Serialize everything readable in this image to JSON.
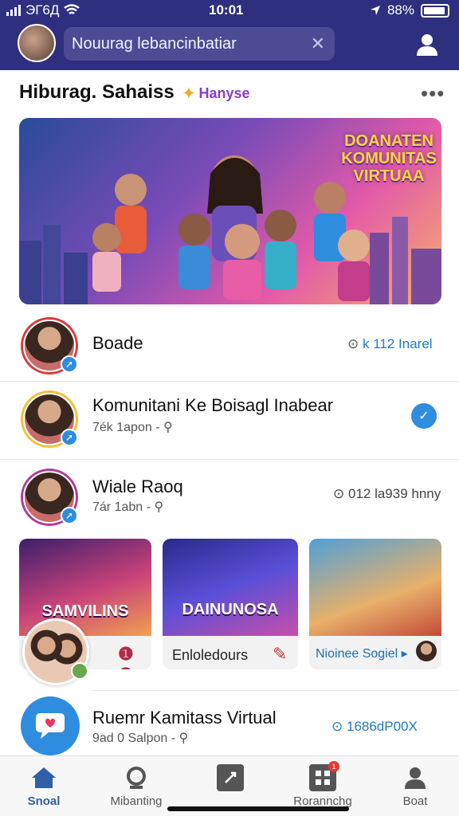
{
  "status_bar": {
    "carrier": "ЭГ6Д",
    "time": "10:01",
    "battery": "88%"
  },
  "header": {
    "search_placeholder": "Nouurag lebancinbatiar",
    "clear_icon": "close-icon",
    "profile_icon": "user-icon"
  },
  "section": {
    "title": "Hiburag. Sahaiss",
    "badge": "Hanyse",
    "more": "•••"
  },
  "banner": {
    "line1": "DOANATEN",
    "line2": "KOMUNITAS",
    "line3": "VIRTUAA"
  },
  "rows": [
    {
      "title": "Boade",
      "subtitle": "",
      "meta": "k 112 Inarel"
    },
    {
      "title": "Komunitani Ke Boisagl Inabear",
      "subtitle": "7ék 1apon -",
      "meta": ""
    },
    {
      "title": "Wiale Raoq",
      "subtitle": "7ár 1abn -",
      "meta": "012 la939 hnny"
    }
  ],
  "cards": [
    {
      "title": "SAMVILINS",
      "caption": "",
      "action": "0"
    },
    {
      "title": "DAINUNOSA",
      "caption": "Enloledours"
    },
    {
      "title": "",
      "caption": "Nioinee Sogiel"
    }
  ],
  "bottom_row": {
    "title": "Ruemr Kamitass Virtual",
    "subtitle": "9ad 0 Salpon -",
    "meta": "1686dP00X"
  },
  "nav": {
    "items": [
      {
        "label": "Snoal",
        "icon": "home-icon",
        "active": true
      },
      {
        "label": "Mibanting",
        "icon": "community-icon",
        "active": false
      },
      {
        "label": "",
        "icon": "link-icon",
        "active": false
      },
      {
        "label": "Rorannchg",
        "icon": "grid-icon",
        "active": false,
        "badge": "1"
      },
      {
        "label": "Boat",
        "icon": "user-icon",
        "active": false
      }
    ]
  },
  "colors": {
    "topbar": "#2e2f7e",
    "accent": "#2f8de0",
    "nav_active": "#2f5fa8"
  }
}
